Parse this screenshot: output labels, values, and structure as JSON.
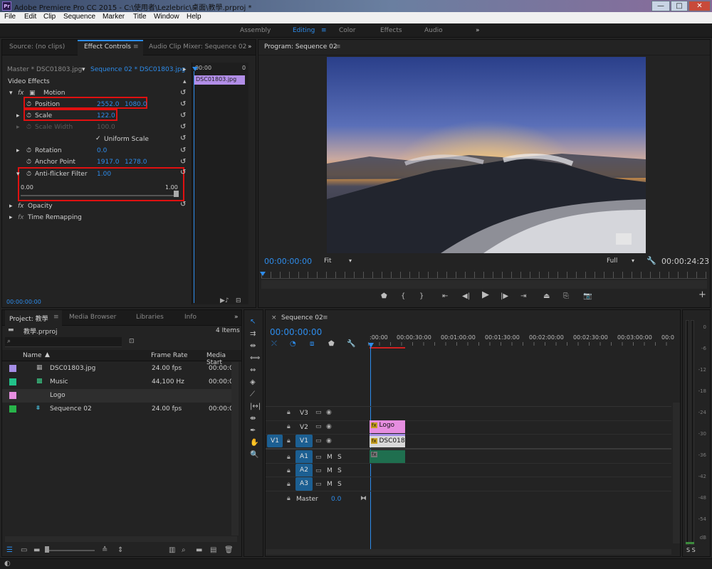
{
  "window": {
    "app_icon": "Pr",
    "title": "Adobe Premiere Pro CC 2015 - C:\\使用者\\Lezlebric\\桌面\\教學.prproj *",
    "minimize": "—",
    "maximize": "□",
    "close": "✕"
  },
  "menu": [
    "File",
    "Edit",
    "Clip",
    "Sequence",
    "Marker",
    "Title",
    "Window",
    "Help"
  ],
  "workspaces": [
    "Assembly",
    "Editing",
    "Color",
    "Effects",
    "Audio"
  ],
  "workspace_more": "»",
  "effect_panel": {
    "tabs": [
      "Source: (no clips)",
      "Effect Controls",
      "Audio Clip Mixer: Sequence 02"
    ],
    "master_label": "Master * DSC01803.jpg",
    "sequence_label": "Sequence 02 * DSC01803.jpg",
    "timeline_time": "00:00",
    "timeline_time2": "0",
    "clip_name": "DSC01803.jpg",
    "section": "Video Effects",
    "motion": "Motion",
    "position_label": "Position",
    "position_x": "2552.0",
    "position_y": "1080.0",
    "scale_label": "Scale",
    "scale_value": "122.0",
    "scale_width_label": "Scale Width",
    "scale_width_value": "100.0",
    "uniform_scale": "Uniform Scale",
    "rotation_label": "Rotation",
    "rotation_value": "0.0",
    "anchor_label": "Anchor Point",
    "anchor_x": "1917.0",
    "anchor_y": "1278.0",
    "antiflicker_label": "Anti-flicker Filter",
    "antiflicker_value": "1.00",
    "slider_min": "0.00",
    "slider_max": "1.00",
    "antiflicker_level": 1.0,
    "opacity": "Opacity",
    "time_remap": "Time Remapping",
    "current_time": "00:00:00:00"
  },
  "program": {
    "title": "Program: Sequence 02",
    "timecode": "00:00:00:00",
    "fit": "Fit",
    "quality": "Full",
    "duration": "00:00:24:23"
  },
  "project": {
    "tabs": [
      "Project: 教學",
      "Media Browser",
      "Libraries",
      "Info"
    ],
    "file": "教學.prproj",
    "count": "4 Items",
    "columns": [
      "Name",
      "Frame Rate",
      "Media Start"
    ],
    "items": [
      {
        "name": "DSC01803.jpg",
        "rate": "24.00 fps",
        "start": "00:00:0",
        "color": "#a58ee6"
      },
      {
        "name": "Music",
        "rate": "44,100 Hz",
        "start": "00:00:0",
        "color": "#22c28a"
      },
      {
        "name": "Logo",
        "rate": "",
        "start": "",
        "color": "#e68ee0"
      },
      {
        "name": "Sequence 02",
        "rate": "24.00 fps",
        "start": "00:00:0",
        "color": "#28b44a"
      }
    ]
  },
  "timeline": {
    "title": "Sequence 02",
    "timecode": "00:00:00:00",
    "ruler": [
      ":00:00",
      "00:00:30:00",
      "00:01:00:00",
      "00:01:30:00",
      "00:02:00:00",
      "00:02:30:00",
      "00:03:00:00",
      "00:0"
    ],
    "tracks": [
      "V3",
      "V2",
      "V1",
      "A1",
      "A2",
      "A3"
    ],
    "v1_source": "V1",
    "master": "Master",
    "master_value": "0.0",
    "mute": "M",
    "solo": "S",
    "clips": {
      "logo": "Logo",
      "image": "DSC018",
      "fx": "fx"
    }
  },
  "meter": {
    "labels": [
      "0",
      "-6",
      "-12",
      "-18",
      "-24",
      "-30",
      "-36",
      "-42",
      "-48",
      "-54",
      "dB"
    ],
    "footer": "S S"
  },
  "colors": {
    "accent": "#2d8ceb",
    "highlight": "#e01010",
    "logo_clip": "#e68ee0",
    "image_clip": "#a58ee6",
    "audio_clip": "#1f6f4f"
  }
}
